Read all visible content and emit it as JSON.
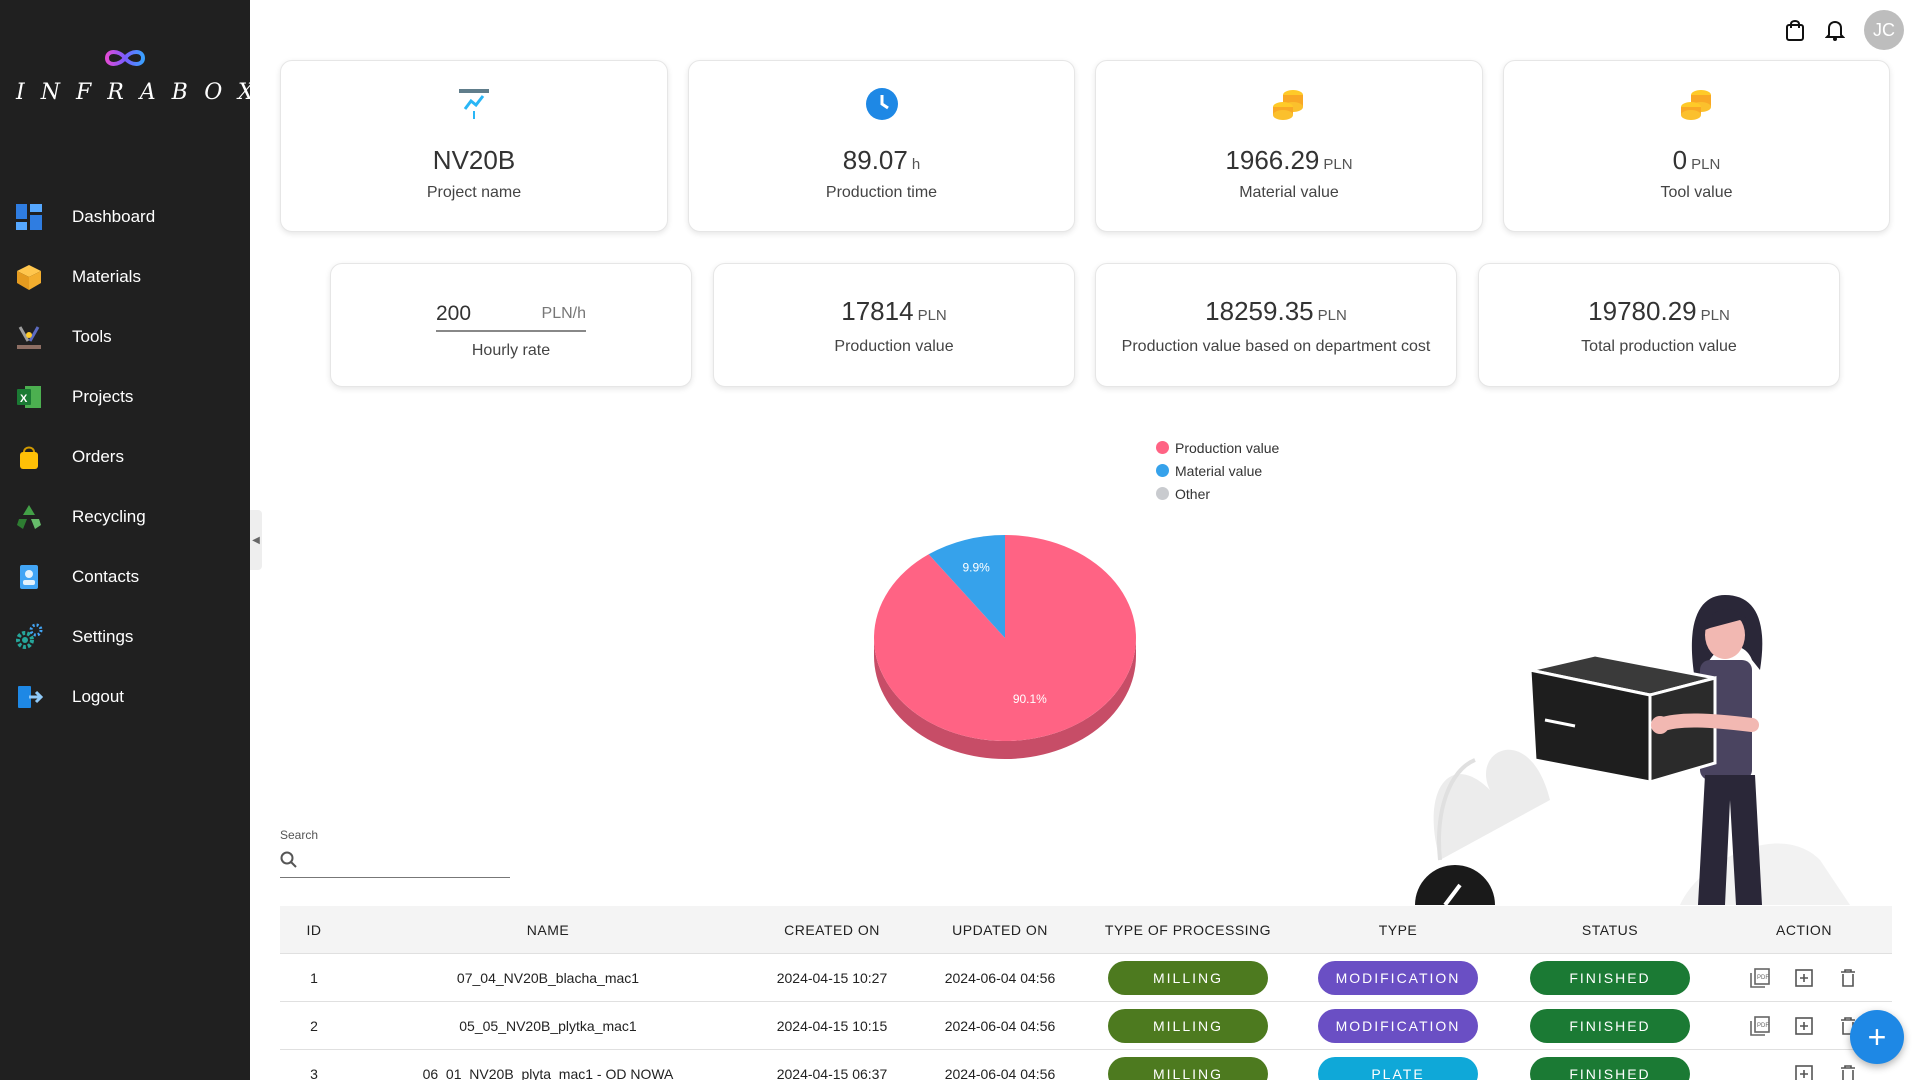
{
  "app": {
    "logo_text": "INFRABOX"
  },
  "sidebar": {
    "items": [
      {
        "label": "Dashboard",
        "icon": "dashboard-icon"
      },
      {
        "label": "Materials",
        "icon": "box-icon"
      },
      {
        "label": "Tools",
        "icon": "tools-icon"
      },
      {
        "label": "Projects",
        "icon": "excel-icon"
      },
      {
        "label": "Orders",
        "icon": "shopping-bag-icon"
      },
      {
        "label": "Recycling",
        "icon": "recycle-icon"
      },
      {
        "label": "Contacts",
        "icon": "contact-icon"
      },
      {
        "label": "Settings",
        "icon": "gear-icon"
      },
      {
        "label": "Logout",
        "icon": "logout-icon"
      }
    ]
  },
  "header": {
    "avatar_initials": "JC"
  },
  "stats_top": [
    {
      "value": "NV20B",
      "unit": "",
      "label": "Project name",
      "icon": "chart-icon"
    },
    {
      "value": "89.07",
      "unit": "h",
      "label": "Production time",
      "icon": "clock-icon"
    },
    {
      "value": "1966.29",
      "unit": "PLN",
      "label": "Material value",
      "icon": "coins-icon"
    },
    {
      "value": "0",
      "unit": "PLN",
      "label": "Tool value",
      "icon": "coins-icon"
    }
  ],
  "hourly_rate": {
    "value": "200",
    "unit": "PLN/h",
    "label": "Hourly rate"
  },
  "stats_bottom": [
    {
      "value": "17814",
      "unit": "PLN",
      "label": "Production value"
    },
    {
      "value": "18259.35",
      "unit": "PLN",
      "label": "Production value based on department cost"
    },
    {
      "value": "19780.29",
      "unit": "PLN",
      "label": "Total production value"
    }
  ],
  "chart_data": {
    "type": "pie",
    "legend_position": "top",
    "labels": [
      "Production value",
      "Material value",
      "Other"
    ],
    "values": [
      90.1,
      9.9,
      0
    ],
    "data_labels": [
      "90.1%",
      "9.9%",
      ""
    ],
    "colors": [
      "#ff6384",
      "#36a2eb",
      "#c9cbcf"
    ]
  },
  "search": {
    "label": "Search",
    "value": ""
  },
  "table": {
    "columns": [
      "ID",
      "NAME",
      "CREATED ON",
      "UPDATED ON",
      "TYPE OF PROCESSING",
      "TYPE",
      "STATUS",
      "ACTION"
    ],
    "rows": [
      {
        "id": "1",
        "name": "07_04_NV20B_blacha_mac1",
        "created": "2024-04-15 10:27",
        "updated": "2024-06-04 04:56",
        "processing": "MILLING",
        "type": "MODIFICATION",
        "status": "FINISHED"
      },
      {
        "id": "2",
        "name": "05_05_NV20B_plytka_mac1",
        "created": "2024-04-15 10:15",
        "updated": "2024-06-04 04:56",
        "processing": "MILLING",
        "type": "MODIFICATION",
        "status": "FINISHED"
      },
      {
        "id": "3",
        "name": "06_01_NV20B_plyta_mac1 - OD NOWA",
        "created": "2024-04-15 06:37",
        "updated": "2024-06-04 04:56",
        "processing": "MILLING",
        "type": "PLATE",
        "status": "FINISHED"
      }
    ]
  },
  "colors": {
    "sidebar_bg": "#202020",
    "milling": "#4d7a1f",
    "modification": "#6a4fc4",
    "plate": "#0fa8d8",
    "finished": "#1b7a34",
    "fab": "#1e88e5"
  },
  "fab": {
    "label": "+"
  }
}
